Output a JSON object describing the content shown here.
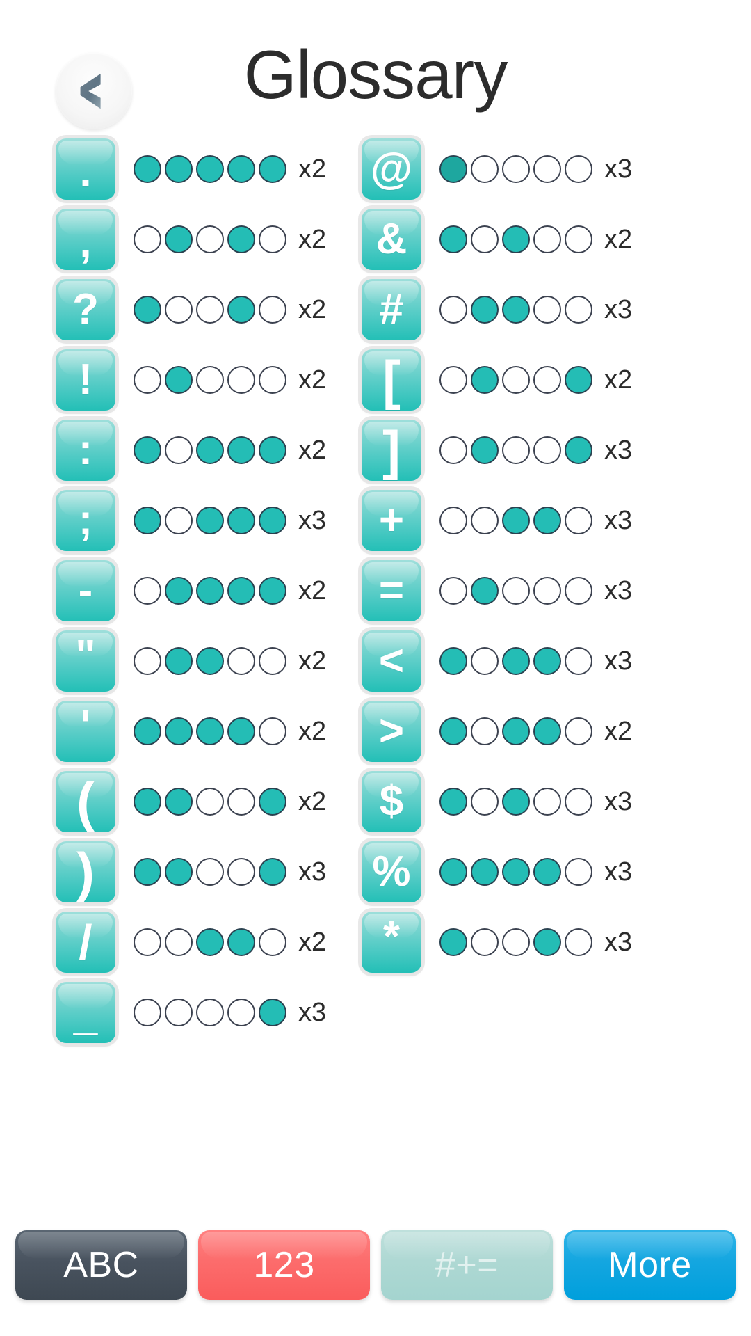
{
  "header": {
    "title": "Glossary",
    "back_icon": "chevron-left-icon"
  },
  "columns": {
    "left": [
      {
        "key": ".",
        "glyph_class": "g-low",
        "dots": [
          1,
          1,
          1,
          1,
          1
        ],
        "multiplier": "x2"
      },
      {
        "key": ",",
        "glyph_class": "g-low",
        "dots": [
          0,
          1,
          0,
          1,
          0
        ],
        "multiplier": "x2"
      },
      {
        "key": "?",
        "glyph_class": "g-mid",
        "dots": [
          1,
          0,
          0,
          1,
          0
        ],
        "multiplier": "x2"
      },
      {
        "key": "!",
        "glyph_class": "g-mid",
        "dots": [
          0,
          1,
          0,
          0,
          0
        ],
        "multiplier": "x2"
      },
      {
        "key": ":",
        "glyph_class": "g-mid",
        "dots": [
          1,
          0,
          1,
          1,
          1
        ],
        "multiplier": "x2"
      },
      {
        "key": ";",
        "glyph_class": "g-mid",
        "dots": [
          1,
          0,
          1,
          1,
          1
        ],
        "multiplier": "x3"
      },
      {
        "key": "-",
        "glyph_class": "g-mid",
        "dots": [
          0,
          1,
          1,
          1,
          1
        ],
        "multiplier": "x2"
      },
      {
        "key": "\"",
        "glyph_class": "g-high",
        "dots": [
          0,
          1,
          1,
          0,
          0
        ],
        "multiplier": "x2"
      },
      {
        "key": "'",
        "glyph_class": "g-high",
        "dots": [
          1,
          1,
          1,
          1,
          0
        ],
        "multiplier": "x2"
      },
      {
        "key": "(",
        "glyph_class": "g-tall",
        "dots": [
          1,
          1,
          0,
          0,
          1
        ],
        "multiplier": "x2"
      },
      {
        "key": ")",
        "glyph_class": "g-tall",
        "dots": [
          1,
          1,
          0,
          0,
          1
        ],
        "multiplier": "x3"
      },
      {
        "key": "/",
        "glyph_class": "g-big",
        "dots": [
          0,
          0,
          1,
          1,
          0
        ],
        "multiplier": "x2"
      },
      {
        "key": "_",
        "glyph_class": "g-low",
        "dots": [
          0,
          0,
          0,
          0,
          1
        ],
        "multiplier": "x3"
      }
    ],
    "right": [
      {
        "key": "@",
        "glyph_class": "g-mid",
        "dots": [
          2,
          0,
          0,
          0,
          0
        ],
        "multiplier": "x3"
      },
      {
        "key": "&",
        "glyph_class": "g-mid",
        "dots": [
          1,
          0,
          1,
          0,
          0
        ],
        "multiplier": "x2"
      },
      {
        "key": "#",
        "glyph_class": "g-mid",
        "dots": [
          0,
          1,
          1,
          0,
          0
        ],
        "multiplier": "x3"
      },
      {
        "key": "[",
        "glyph_class": "g-tall",
        "dots": [
          0,
          1,
          0,
          0,
          1
        ],
        "multiplier": "x2"
      },
      {
        "key": "]",
        "glyph_class": "g-tall",
        "dots": [
          0,
          1,
          0,
          0,
          1
        ],
        "multiplier": "x3"
      },
      {
        "key": "+",
        "glyph_class": "g-mid",
        "dots": [
          0,
          0,
          1,
          1,
          0
        ],
        "multiplier": "x3"
      },
      {
        "key": "=",
        "glyph_class": "g-mid",
        "dots": [
          0,
          1,
          0,
          0,
          0
        ],
        "multiplier": "x3"
      },
      {
        "key": "<",
        "glyph_class": "g-mid",
        "dots": [
          1,
          0,
          1,
          1,
          0
        ],
        "multiplier": "x3"
      },
      {
        "key": ">",
        "glyph_class": "g-mid",
        "dots": [
          1,
          0,
          1,
          1,
          0
        ],
        "multiplier": "x2"
      },
      {
        "key": "$",
        "glyph_class": "g-mid",
        "dots": [
          1,
          0,
          1,
          0,
          0
        ],
        "multiplier": "x3"
      },
      {
        "key": "%",
        "glyph_class": "g-mid",
        "dots": [
          1,
          1,
          1,
          1,
          0
        ],
        "multiplier": "x3"
      },
      {
        "key": "*",
        "glyph_class": "g-high",
        "dots": [
          1,
          0,
          0,
          1,
          0
        ],
        "multiplier": "x3"
      }
    ]
  },
  "bottom_bar": {
    "buttons": [
      {
        "label": "ABC",
        "style": "abc",
        "name": "mode-button-abc"
      },
      {
        "label": "123",
        "style": "num",
        "name": "mode-button-123"
      },
      {
        "label": "#+=",
        "style": "sym",
        "name": "mode-button-symbols"
      },
      {
        "label": "More",
        "style": "more",
        "name": "mode-button-more"
      }
    ]
  },
  "colors": {
    "key_teal": "#24bdb5",
    "key_teal_light": "#9fdfdb",
    "dot_filled": "#24bdb5",
    "dot_filled_dark": "#1ea79f",
    "dot_outline": "#3c4250",
    "abc_gray": "#49535f",
    "num_red": "#fc6c6c",
    "sym_pale": "#aed8d3",
    "more_blue": "#14a6e0",
    "title_text": "#2c2c2c",
    "background": "#ffffff"
  }
}
